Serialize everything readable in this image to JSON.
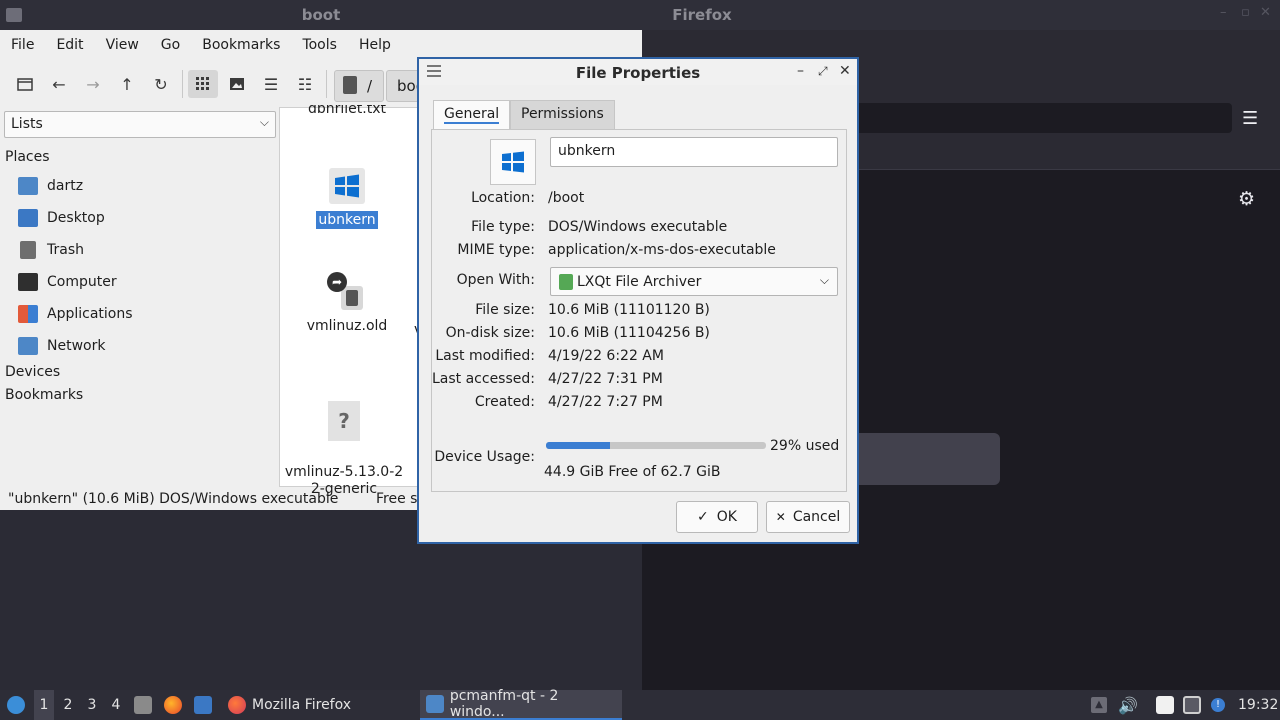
{
  "firefox": {
    "title": "Firefox"
  },
  "file_manager": {
    "title": "boot",
    "menu": [
      "File",
      "Edit",
      "View",
      "Go",
      "Bookmarks",
      "Tools",
      "Help"
    ],
    "path": "/",
    "path_segment": "boo",
    "side_combo": "Lists",
    "places_header": "Places",
    "places": [
      {
        "label": "dartz",
        "icon": "home-folder-icon"
      },
      {
        "label": "Desktop",
        "icon": "desktop-icon"
      },
      {
        "label": "Trash",
        "icon": "trash-icon"
      },
      {
        "label": "Computer",
        "icon": "computer-icon"
      },
      {
        "label": "Applications",
        "icon": "applications-icon"
      },
      {
        "label": "Network",
        "icon": "network-icon"
      }
    ],
    "devices_header": "Devices",
    "bookmarks_header": "Bookmarks",
    "files": [
      {
        "label": "dbnrilet.txt"
      },
      {
        "label": "ubnkern",
        "selected": true,
        "icon": "windows-icon"
      },
      {
        "label": "vmlinuz.old",
        "icon": "trash-icon"
      },
      {
        "label": "vmlinuz-5.13.0-2\n2-generic",
        "icon": "unknown-file-icon"
      }
    ],
    "partial_second_column": "v",
    "status_left": "\"ubnkern\" (10.6 MiB) DOS/Windows executable",
    "status_right": "Free s"
  },
  "dialog": {
    "title": "File Properties",
    "tabs": [
      "General",
      "Permissions"
    ],
    "name_value": "ubnkern",
    "location_label": "Location:",
    "location_value": "/boot",
    "filetype_label": "File type:",
    "filetype_value": "DOS/Windows executable",
    "mime_label": "MIME type:",
    "mime_value": "application/x-ms-dos-executable",
    "openwith_label": "Open With:",
    "openwith_value": "LXQt File Archiver",
    "filesize_label": "File size:",
    "filesize_value": "10.6 MiB (11101120 B)",
    "disksize_label": "On-disk size:",
    "disksize_value": "10.6 MiB (11104256 B)",
    "modified_label": "Last modified:",
    "modified_value": "4/19/22 6:22 AM",
    "accessed_label": "Last accessed:",
    "accessed_value": "4/27/22 7:31 PM",
    "created_label": "Created:",
    "created_value": "4/27/22 7:27 PM",
    "usage_label": "Device Usage:",
    "usage_percent": 29,
    "usage_text": "29% used",
    "usage_free": "44.9 GiB Free of 62.7 GiB",
    "ok_label": "OK",
    "cancel_label": "Cancel"
  },
  "taskbar": {
    "workspaces": [
      "1",
      "2",
      "3",
      "4"
    ],
    "active_workspace": "1",
    "tasks": [
      {
        "label": "Mozilla Firefox"
      },
      {
        "label": "pcmanfm-qt - 2 windo..."
      }
    ],
    "clock": "19:32"
  },
  "colors": {
    "accent": "#3b7ed2",
    "panel_dark": "#2d2d37",
    "firefox_bg": "#1c1b22"
  }
}
